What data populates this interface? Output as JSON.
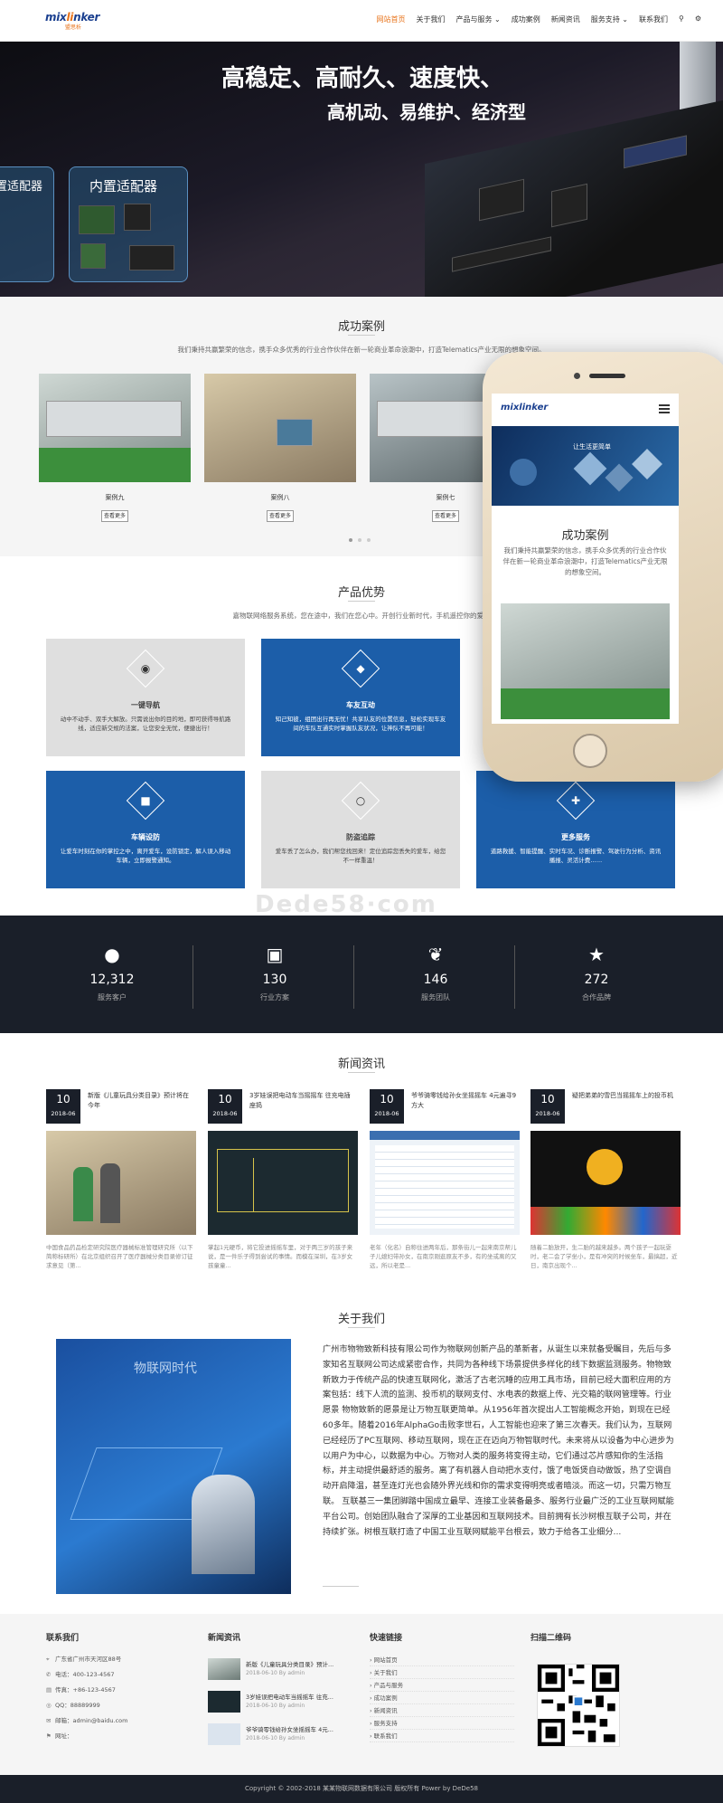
{
  "header": {
    "logo_text": "mixlinker",
    "logo_sub": "盟思析",
    "nav": [
      {
        "label": "网站首页",
        "active": true
      },
      {
        "label": "关于我们",
        "active": false
      },
      {
        "label": "产品与服务 ⌄",
        "active": false
      },
      {
        "label": "成功案例",
        "active": false
      },
      {
        "label": "新闻资讯",
        "active": false
      },
      {
        "label": "服务支持 ⌄",
        "active": false
      },
      {
        "label": "联系我们",
        "active": false
      }
    ]
  },
  "banner": {
    "line1": "高稳定、高耐久、速度快、",
    "line2": "高机动、易维护、经济型",
    "adapter_left": "置适配器",
    "adapter_right": "内置适配器"
  },
  "cases": {
    "title": "成功案例",
    "desc": "我们秉持共赢繁荣的信念，携手众多优秀的行业合作伙伴在新一轮商业革命浪潮中，打造Telematics产业无限的想象空间。",
    "items": [
      {
        "label": "案例九",
        "button": "查看更多"
      },
      {
        "label": "案例八",
        "button": "查看更多"
      },
      {
        "label": "案例七",
        "button": "查看更多"
      }
    ]
  },
  "phone": {
    "logo": "mixlinker",
    "hero_text": "让生活更简单",
    "title": "成功案例",
    "desc": "我们秉持共赢繁荣的信念，携手众多优秀的行业合作伙伴在新一轮商业革命浪潮中，打造Telematics产业无限的想象空间。"
  },
  "advantages": {
    "title": "产品优势",
    "desc": "嘉物联网络服务系统，您在途中，我们在您心中。开创行业新时代，手机遥控你的爱车",
    "items": [
      {
        "title": "一键导航",
        "desc": "动中不动手、双手大解放。只需说出你的目的地，即可获得导航路线，适应新交规的法案，让您安全无忧，便捷出行！",
        "style": "gray",
        "icon": "globe-icon",
        "glyph": "◉"
      },
      {
        "title": "车友互动",
        "desc": "知己知彼，组团出行再无忧！共享队友的位置信息，轻松实现车友间的车队互通实时掌握队友状况，让神队不再可能！",
        "style": "blue",
        "icon": "chat-icon",
        "glyph": "◆"
      },
      {
        "title": "车辆设防",
        "desc": "让爱车时刻在你的掌控之中，离开爱车，设防锁定，解人误入移动车辆，立即报警通知。",
        "style": "blue",
        "icon": "lock-icon",
        "glyph": "■"
      },
      {
        "title": "防盗追踪",
        "desc": "爱车丢了怎么办，我们帮您找回来！定位追踪您丢失的爱车，给您不一样重温！",
        "style": "gray",
        "icon": "search-icon",
        "glyph": "○"
      },
      {
        "title": "更多服务",
        "desc": "道路救援、智能提醒、实时车况、诊断报警、驾驶行为分析、资讯播报、灵活计费……",
        "style": "blue",
        "icon": "plus-icon",
        "glyph": "✚"
      }
    ]
  },
  "watermark": "Dede58·com",
  "stats": [
    {
      "value": "12,312",
      "label": "服务客户",
      "icon": "users-icon",
      "glyph": "●"
    },
    {
      "value": "130",
      "label": "行业方案",
      "icon": "cubes-icon",
      "glyph": "▣"
    },
    {
      "value": "146",
      "label": "服务团队",
      "icon": "leaf-icon",
      "glyph": "❦"
    },
    {
      "value": "272",
      "label": "合作品牌",
      "icon": "star-icon",
      "glyph": "★"
    }
  ],
  "news": {
    "title": "新闻资讯",
    "items": [
      {
        "day": "10",
        "month": "2018-06",
        "title": "新版《儿童玩具分类目录》预计将在今年",
        "desc": "中国食品药品检定研究院医疗器械标准管理研究所（以下简称标研所）在北京组织召开了医疗器械分类目录修订征求意见（第..."
      },
      {
        "day": "10",
        "month": "2018-06",
        "title": "3岁娃误把电动车当摇摇车 往充电插座捣",
        "desc": "掌起1元硬币，将它投进摇摇车里，对于两三岁的孩子来说，是一件乐子得到尝试的事情。而模在深圳，在3岁女孩童童..."
      },
      {
        "day": "10",
        "month": "2018-06",
        "title": "爷爷骑零钱给孙女坐摇摇车 4元遍寻9方大",
        "desc": "老年（化名）自称住进两年后，那条街儿一起来南京帮儿子儿媳妇带孙女，在南京刚逛原友不多，有的坐或离的又远，所以老是..."
      },
      {
        "day": "10",
        "month": "2018-06",
        "title": "疑把弟弟的雪巴当摇摇车上的投币机",
        "desc": "随着二胎放开，生二胎的越来越多。两个孩子一起玩耍时，老二会了学坐小，是有冲突的时候坐车，最搞超，近日，南京出现个..."
      }
    ]
  },
  "about": {
    "title": "关于我们",
    "img_text": "物联网时代",
    "text": "广州市物物致新科技有限公司作为物联网创新产品的革新者，从诞生以来就备受瞩目，先后与多家知名互联网公司达成紧密合作，共同为各种线下场景提供多样化的线下数据监测服务。物物致新致力于传统产品的快速互联网化，激活了古老沉睡的应用工具市场，目前已经大面积应用的方案包括：线下人流的监测、投币机的联网支付、水电表的数据上传、光交箱的联网管理等。行业愿景 物物致新的愿景是让万物互联更简单。从1956年首次提出人工智能概念开始，到现在已经60多年。随着2016年AlphaGo击败李世石，人工智能也迎来了第三次春天。我们认为，互联网已经经历了PC互联网、移动互联网，现在正在迈向万物智联时代。未来将从以设备为中心进步为以用户为中心，以数据为中心。万物对人类的服务将变得主动，它们通过芯片感知你的生活指标，并主动提供最舒适的服务。离了有机器人自动把水支付，饿了电饭煲自动做饭，热了空调自动开启降温，甚至连灯光也会随外界光线和你的需求变得明亮或者暗淡。而这一切，只需万物互联。 互联基三一集团脚踏中国成立最早、连接工业装备最多、服务行业最广泛的工业互联网赋能平台公司。创始团队融合了深厚的工业基因和互联网技术。目前拥有长沙树根互联子公司，并在持续扩张。树根互联打造了中国工业互联网赋能平台根云，致力于给各工业细分..."
  },
  "footer": {
    "contact_title": "联系我们",
    "contact": [
      {
        "icon": "location-icon",
        "glyph": "⌖",
        "text": "广东省广州市天河区88号"
      },
      {
        "icon": "phone-icon",
        "glyph": "✆",
        "text": "电话：400-123-4567"
      },
      {
        "icon": "fax-icon",
        "glyph": "▤",
        "text": "传真：+86-123-4567"
      },
      {
        "icon": "qq-icon",
        "glyph": "◎",
        "text": "QQ：88889999"
      },
      {
        "icon": "mail-icon",
        "glyph": "✉",
        "text": "邮箱：admin@baidu.com"
      },
      {
        "icon": "pin-icon",
        "glyph": "⚑",
        "text": "网址："
      }
    ],
    "news_title": "新闻资讯",
    "news": [
      {
        "title": "新版《儿童玩具分类目录》预计...",
        "date": "2018-06-10 By admin"
      },
      {
        "title": "3岁娃误把电动车当摇摇车 往充...",
        "date": "2018-06-10 By admin"
      },
      {
        "title": "爷爷骑零钱给孙女坐摇摇车 4元...",
        "date": "2018-06-10 By admin"
      }
    ],
    "links_title": "快速链接",
    "links": [
      "网站首页",
      "关于我们",
      "产品与服务",
      "成功案例",
      "新闻资讯",
      "服务支持",
      "联系我们"
    ],
    "qr_title": "扫描二维码",
    "copyright": "Copyright © 2002-2018 某某物联网数据有限公司 版权所有 Power by DeDe58"
  }
}
